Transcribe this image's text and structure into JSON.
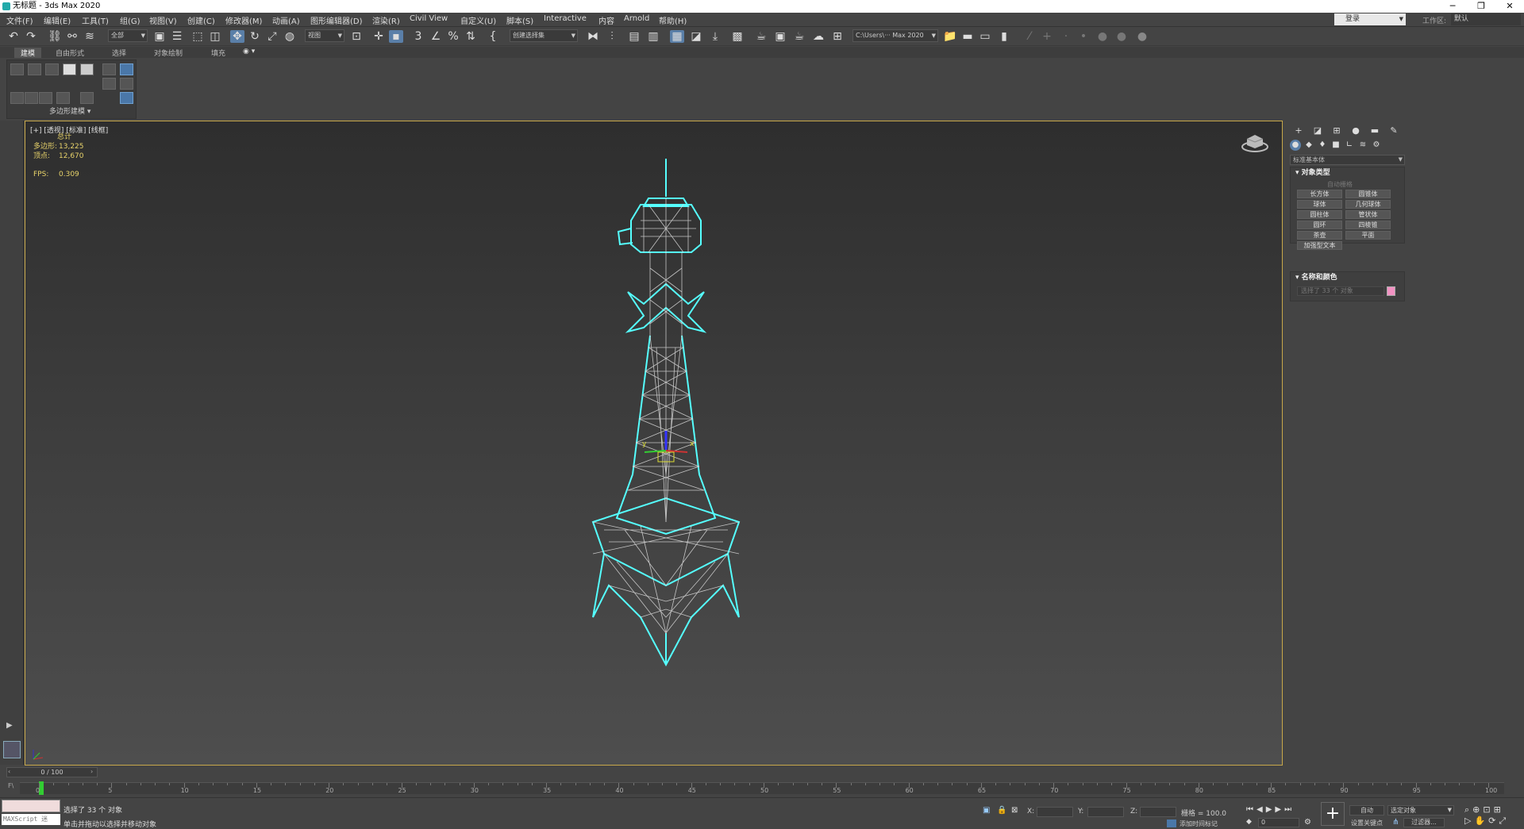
{
  "window": {
    "title": "无标题 - 3ds Max 2020",
    "minimize": "─",
    "restore": "❐",
    "close": "✕"
  },
  "menu": {
    "items": [
      "文件(F)",
      "编辑(E)",
      "工具(T)",
      "组(G)",
      "视图(V)",
      "创建(C)",
      "修改器(M)",
      "动画(A)",
      "图形编辑器(D)",
      "渲染(R)",
      "Civil View",
      "自定义(U)",
      "脚本(S)",
      "Interactive",
      "内容",
      "Arnold",
      "帮助(H)"
    ],
    "login": "登录",
    "workspace_label": "工作区:",
    "workspace_value": "默认"
  },
  "toolbar": {
    "filter_combo": "全部",
    "view_combo": "视图",
    "selection_set": "创建选择集",
    "project_path": "C:\\Users\\··· Max 2020"
  },
  "ribbon": {
    "tabs": [
      "建模",
      "自由形式",
      "选择",
      "对象绘制",
      "填充"
    ],
    "active_tab": "建模",
    "panel_label": "多边形建模 ▾"
  },
  "viewport": {
    "label": "[+] [透视] [标准] [线框]",
    "stats_title": "总计",
    "polys_label": "多边形:",
    "polys_value": "13,225",
    "verts_label": "顶点:",
    "verts_value": "12,670",
    "fps_label": "FPS:",
    "fps_value": "0.309",
    "axis_x": "x",
    "axis_y": "y"
  },
  "command_panel": {
    "category": "标准基本体",
    "object_type_title": "对象类型",
    "autogrid": "自动栅格",
    "objects": [
      "长方体",
      "圆锥体",
      "球体",
      "几何球体",
      "圆柱体",
      "管状体",
      "圆环",
      "四棱锥",
      "茶壶",
      "平面",
      "加强型文本"
    ],
    "name_color_title": "名称和颜色",
    "name_placeholder": "选择了 33 个 对象",
    "object_color": "#f293c3"
  },
  "timeline": {
    "slider": "0 / 100",
    "ticks": [
      0,
      5,
      10,
      15,
      20,
      25,
      30,
      35,
      40,
      45,
      50,
      55,
      60,
      65,
      70,
      75,
      80,
      85,
      90,
      95,
      100
    ]
  },
  "status": {
    "maxscript": "MAXScript 迷",
    "selection": "选择了 33 个 对象",
    "prompt": "单击并拖动以选择并移动对象",
    "x_label": "X:",
    "y_label": "Y:",
    "z_label": "Z:",
    "grid": "栅格 = 100.0",
    "add_time_tag": "添加时间标记",
    "frame": "0",
    "auto_key": "自动",
    "selected_objects": "选定对象",
    "set_key": "设置关键点",
    "filters": "过滤器..."
  }
}
